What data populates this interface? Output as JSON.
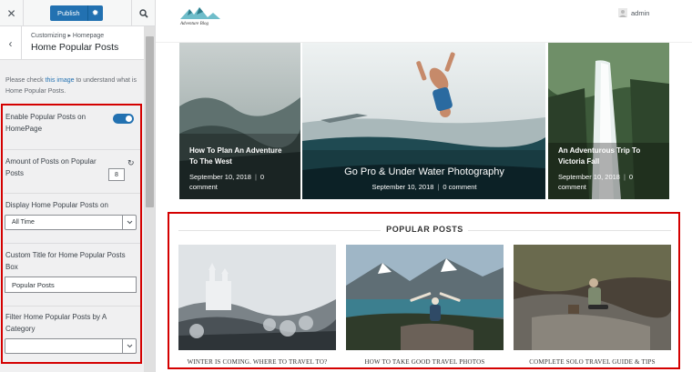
{
  "customizer": {
    "publish_label": "Publish",
    "close_icon": "close-icon",
    "breadcrumb": "Customizing ▸ Homepage",
    "section_title": "Home Popular Posts",
    "help_before": "Please check ",
    "help_link": "this image",
    "help_after": " to understand what is Home Popular Posts.",
    "controls": {
      "enable_label": "Enable Popular Posts on HomePage",
      "enable_on": true,
      "amount_label": "Amount of Posts on Popular Posts",
      "amount_value": "8",
      "display_label": "Display Home Popular Posts on",
      "display_value": "All Time",
      "title_label": "Custom Title for Home Popular Posts Box",
      "title_value": "Popular Posts",
      "filter_label": "Filter Home Popular Posts by A Category",
      "filter_value": ""
    },
    "accent_color": "#2271b1",
    "highlight_color": "#d40000"
  },
  "preview": {
    "user_label": "admin",
    "slides": [
      {
        "title": "How To Plan An Adventure To The West",
        "date": "September 10, 2018",
        "comments": "0 comment"
      },
      {
        "title": "Go Pro & Under Water Photography",
        "date": "September 10, 2018",
        "comments": "0 comment"
      },
      {
        "title": "An Adventurous Trip To Victoria Fall",
        "date": "September 10, 2018",
        "comments": "0 comment"
      }
    ],
    "popular": {
      "heading": "POPULAR POSTS",
      "posts": [
        {
          "title": "WINTER IS COMING. WHERE TO TRAVEL TO?"
        },
        {
          "title": "HOW TO TAKE GOOD TRAVEL PHOTOS"
        },
        {
          "title": "COMPLETE SOLO TRAVEL GUIDE & TIPS"
        }
      ]
    }
  }
}
